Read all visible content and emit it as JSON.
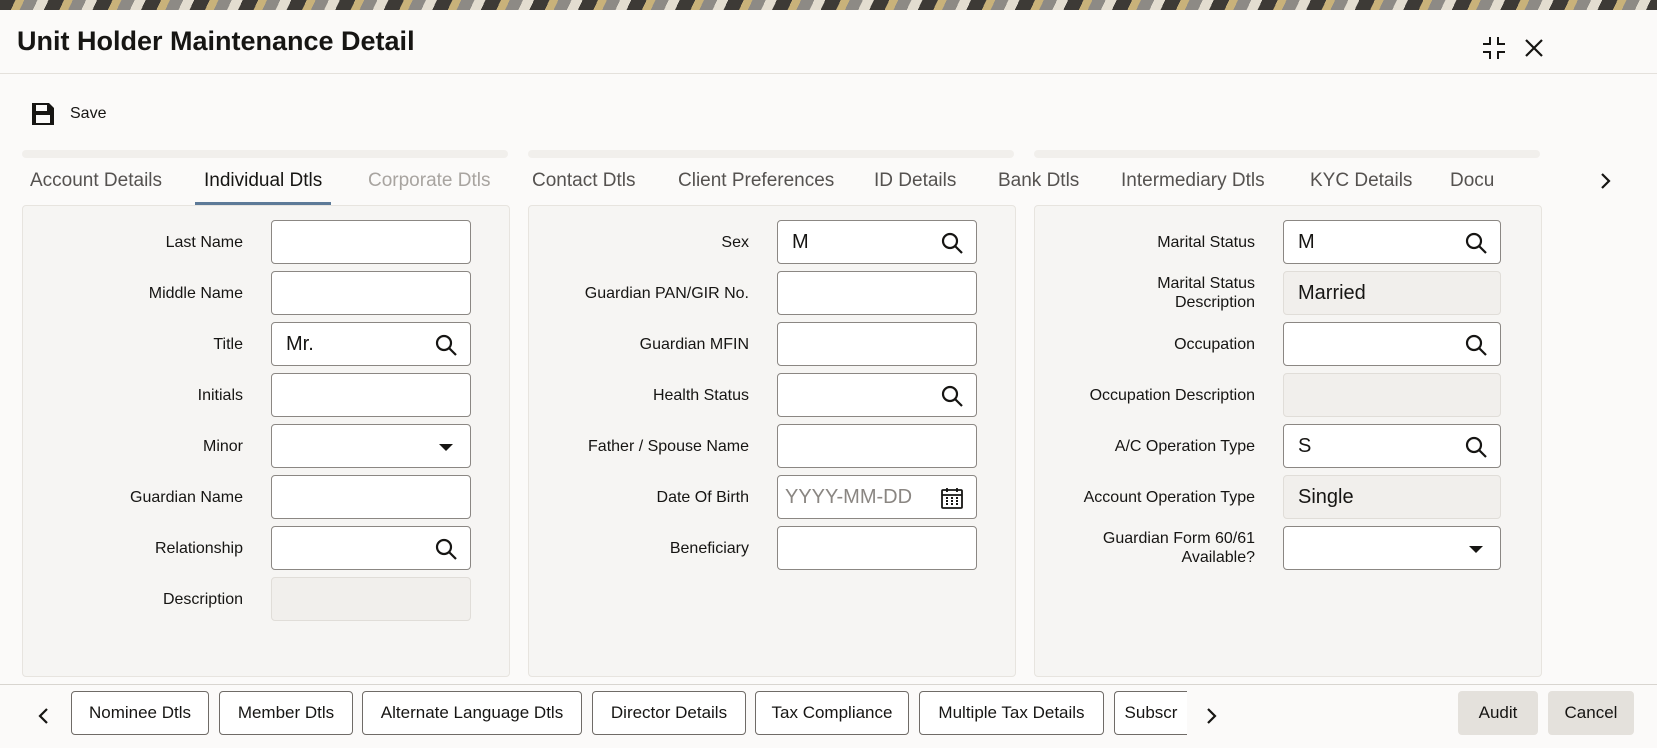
{
  "window": {
    "title": "Unit Holder Maintenance Detail"
  },
  "toolbar": {
    "save_label": "Save"
  },
  "tabs": [
    {
      "label": "Account Details",
      "state": "normal"
    },
    {
      "label": "Individual Dtls",
      "state": "active"
    },
    {
      "label": "Corporate Dtls",
      "state": "disabled"
    },
    {
      "label": "Contact Dtls",
      "state": "normal"
    },
    {
      "label": "Client Preferences",
      "state": "normal"
    },
    {
      "label": "ID Details",
      "state": "normal"
    },
    {
      "label": "Bank Dtls",
      "state": "normal"
    },
    {
      "label": "Intermediary Dtls",
      "state": "normal"
    },
    {
      "label": "KYC Details",
      "state": "normal"
    },
    {
      "label": "Docu",
      "state": "normal"
    }
  ],
  "col1": {
    "last_name": {
      "label": "Last Name",
      "value": ""
    },
    "middle_name": {
      "label": "Middle Name",
      "value": ""
    },
    "title": {
      "label": "Title",
      "value": "Mr."
    },
    "initials": {
      "label": "Initials",
      "value": ""
    },
    "minor": {
      "label": "Minor",
      "value": ""
    },
    "guardian_name": {
      "label": "Guardian Name",
      "value": ""
    },
    "relationship": {
      "label": "Relationship",
      "value": ""
    },
    "description": {
      "label": "Description",
      "value": ""
    }
  },
  "col2": {
    "sex": {
      "label": "Sex",
      "value": "M"
    },
    "guardian_pan": {
      "label": "Guardian PAN/GIR No.",
      "value": ""
    },
    "guardian_mfin": {
      "label": "Guardian MFIN",
      "value": ""
    },
    "health_status": {
      "label": "Health Status",
      "value": ""
    },
    "father_spouse": {
      "label": "Father / Spouse Name",
      "value": ""
    },
    "dob": {
      "label": "Date Of Birth",
      "value": "",
      "placeholder": "YYYY-MM-DD"
    },
    "beneficiary": {
      "label": "Beneficiary",
      "value": ""
    }
  },
  "col3": {
    "marital_status": {
      "label": "Marital Status",
      "value": "M"
    },
    "marital_desc": {
      "label_line1": "Marital Status",
      "label_line2": "Description",
      "value": "Married"
    },
    "occupation": {
      "label": "Occupation",
      "value": ""
    },
    "occupation_desc": {
      "label": "Occupation Description",
      "value": ""
    },
    "ac_op_type": {
      "label": "A/C Operation Type",
      "value": "S"
    },
    "account_op_type": {
      "label": "Account Operation Type",
      "value": "Single"
    },
    "guardian_form": {
      "label_line1": "Guardian Form 60/61",
      "label_line2": "Available?",
      "value": ""
    }
  },
  "bottom": {
    "buttons": [
      "Nominee Dtls",
      "Member Dtls",
      "Alternate Language Dtls",
      "Director Details",
      "Tax Compliance",
      "Multiple Tax Details",
      "Subscr"
    ],
    "audit_label": "Audit",
    "cancel_label": "Cancel"
  },
  "icons": {
    "maximize": "maximize-icon",
    "close": "close-icon",
    "save": "save-icon",
    "search": "search-icon",
    "calendar": "calendar-icon",
    "dropdown": "chevron-down-icon"
  },
  "colors": {
    "active_tab_underline": "#5d7a98",
    "border": "#8b8783"
  }
}
